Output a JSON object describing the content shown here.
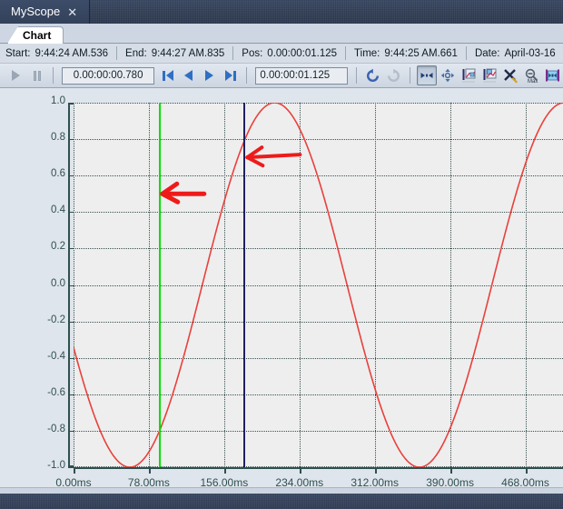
{
  "window": {
    "tab_label": "MyScope",
    "close_icon": "close-icon"
  },
  "tabstrip": {
    "active_tab": "Chart"
  },
  "status": {
    "start_key": "Start:",
    "start_value": "9:44:24 AM.536",
    "end_key": "End:",
    "end_value": "9:44:27 AM.835",
    "pos_key": "Pos:",
    "pos_value": "0.00:00:01.125",
    "time_key": "Time:",
    "time_value": "9:44:25 AM.661",
    "date_key": "Date:",
    "date_value": "April-03-16"
  },
  "toolbar": {
    "play_icon": "play-icon",
    "pause_icon": "pause-icon",
    "interval_field_value": "0.00:00:00.780",
    "first_icon": "skip-to-start-icon",
    "prev_icon": "step-back-icon",
    "next_icon": "step-forward-icon",
    "last_icon": "skip-to-end-icon",
    "position_field_value": "0.00:00:01.125",
    "undo_icon": "undo-icon",
    "redo_icon": "redo-icon",
    "pan_horizontal_icon": "pan-horizontal-icon",
    "pan_all_icon": "pan-all-directions-icon",
    "zoom_left_icon": "zoom-to-left-cursor-icon",
    "zoom_right_icon": "zoom-to-right-cursor-icon",
    "clear_cursors_icon": "clear-cursors-icon",
    "zoom_max_icon": "zoom-max-icon",
    "fit-cursors_icon": "fit-between-cursors-icon"
  },
  "chart_data": {
    "type": "line",
    "title": "",
    "xlabel": "",
    "ylabel": "",
    "xlim": [
      0,
      507
    ],
    "ylim": [
      -1.0,
      1.0
    ],
    "grid": true,
    "legend": "none",
    "x_tick_labels": [
      "0.00ms",
      "78.00ms",
      "156.00ms",
      "234.00ms",
      "312.00ms",
      "390.00ms",
      "468.00ms"
    ],
    "x_tick_values": [
      0,
      78,
      156,
      234,
      312,
      390,
      468
    ],
    "y_tick_labels": [
      "1.0",
      "0.8",
      "0.6",
      "0.4",
      "0.2",
      "0.0",
      "-0.2",
      "-0.4",
      "-0.6",
      "-0.8",
      "-1.0"
    ],
    "y_tick_values": [
      1.0,
      0.8,
      0.6,
      0.4,
      0.2,
      0.0,
      -0.2,
      -0.4,
      -0.6,
      -0.8,
      -1.0
    ],
    "series": [
      {
        "name": "signal",
        "color": "#e8413c",
        "form": "sine",
        "amplitude": 1.0,
        "period_ms": 300,
        "phase_deg": 200,
        "start_value": -0.34
      }
    ],
    "cursors": [
      {
        "name": "left-cursor",
        "color": "#00e000",
        "x_ms": 88
      },
      {
        "name": "right-cursor",
        "color": "#202060",
        "x_ms": 176
      }
    ],
    "annotations": [
      {
        "name": "arrow-to-green-cursor",
        "color": "#ee1b1b",
        "tip_x_ms": 92,
        "tip_y": 0.5
      },
      {
        "name": "arrow-to-navy-cursor",
        "color": "#ee1b1b",
        "tip_x_ms": 180,
        "tip_y": 0.7
      }
    ]
  }
}
